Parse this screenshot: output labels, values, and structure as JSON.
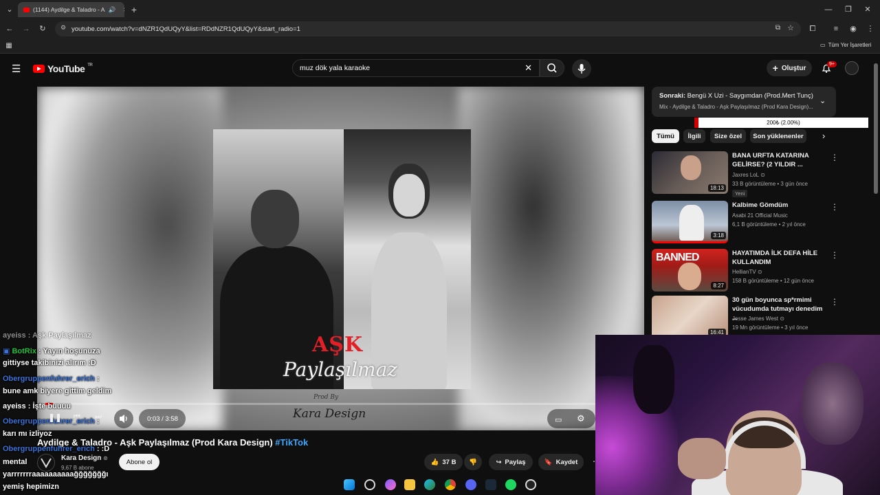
{
  "browser": {
    "tab_title": "(1144) Aydilge & Taladro - A",
    "url": "youtube.com/watch?v=dNZR1QdUQyY&list=RDdNZR1QdUQyY&start_radio=1",
    "bookmarks_label": "Tüm Yer İşaretleri"
  },
  "youtube": {
    "logo_text": "YouTube",
    "region": "TR",
    "search_value": "muz dök yala karaoke",
    "create_label": "Oluştur",
    "notif_badge": "9+"
  },
  "player": {
    "poster_word1": "AŞK",
    "poster_word2": "Paylaşılmaz",
    "poster_prod": "Prod By",
    "poster_brand": "Kara Design",
    "time": "0:03 / 3:58",
    "progress_fraction": 0.013
  },
  "video": {
    "title": "Aydilge & Taladro - Aşk Paylaşılmaz (Prod Kara Design)",
    "hashtag": "#TikTok",
    "channel": "Kara Design",
    "subs": "9,67 B abone",
    "subscribe_label": "Abone ol",
    "likes": "37 B",
    "share_label": "Paylaş",
    "save_label": "Kaydet"
  },
  "sidebar": {
    "upnext_label": "Sonraki:",
    "upnext_title": "Bengü X Uzi - Saygımdan (Prod.Mert Tunç)",
    "upnext_sub": "Mix - Aydilge & Taladro - Aşk Paylaşılmaz (Prod Kara Design)...",
    "donation": "200₺ (2.00%)",
    "chips": [
      "Tümü",
      "İlgili",
      "Size özel",
      "Son yüklenenler"
    ],
    "recs": [
      {
        "title": "BANA URFTA KATARINA GELİRSE? (2 YILDIR ...",
        "channel": "Jaxres LoL",
        "meta": "33 B görüntüleme • 3 gün önce",
        "duration": "18:13",
        "badge": "Yeni"
      },
      {
        "title": "Kalbime Gömdüm",
        "channel": "Asabi 21 Official Music",
        "meta": "6,1 B görüntüleme • 2 yıl önce",
        "duration": "3:18"
      },
      {
        "title": "HAYATIMDA İLK DEFA HİLE KULLANDIM",
        "channel": "HellianTV",
        "meta": "158 B görüntüleme • 12 gün önce",
        "duration": "8:27"
      },
      {
        "title": "30 gün boyunca sp*rmimi vücudumda tutmayı denedim ...",
        "channel": "Jesse James West",
        "meta": "19 Mn görüntüleme • 3 yıl önce",
        "duration": "16:41"
      }
    ]
  },
  "chat": [
    {
      "user": "ayeiss",
      "text": ": Aşk Paylaşılmaz"
    },
    {
      "user": "BotRix",
      "text": ": Yayın hoşunuza"
    },
    {
      "user": "",
      "text": "gittiyse takibinizi alırım :D"
    },
    {
      "user": "Obergruppenfuhrer_erich",
      "text": ":"
    },
    {
      "user": "",
      "text": "bune amk biyere gittim geldim"
    },
    {
      "user": "ayeiss",
      "text": ": İşte buuuu"
    },
    {
      "user": "Obergruppenfuhrer_erich",
      "text": ":"
    },
    {
      "user": "",
      "text": "karı mı izliyoz"
    },
    {
      "user": "Obergruppenfuhrer_erich",
      "text": ": :D"
    },
    {
      "user": "",
      "text": "mental"
    },
    {
      "user": "",
      "text": "yarrrrrrraaaaaaaaaağğğğğğğı"
    },
    {
      "user": "",
      "text": "yemiş hepimizn"
    }
  ],
  "colors": {
    "yt_red": "#ff0000",
    "link_blue": "#3ea6ff",
    "chat_blue": "#3a72d8",
    "chat_green": "#23c23c"
  }
}
